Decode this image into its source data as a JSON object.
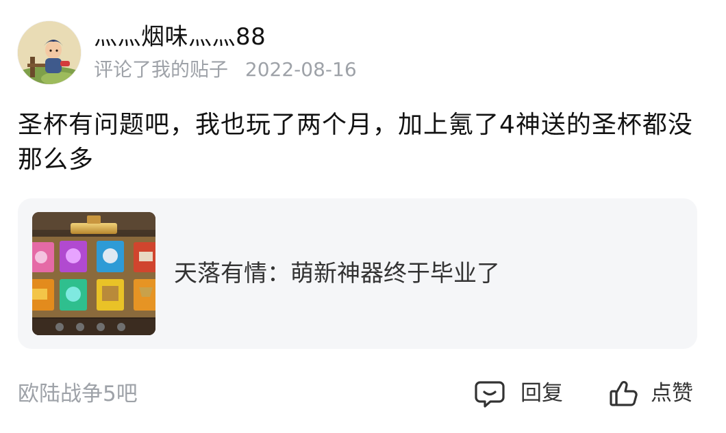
{
  "comment_item": {
    "user": {
      "name": "灬灬烟味灬灬88",
      "avatar": "avatar-icon"
    },
    "meta": {
      "action": "评论了我的贴子",
      "date": "2022-08-16"
    },
    "text": "圣杯有问题吧，我也玩了两个月，加上氪了4神送的圣杯都没那么多",
    "quoted_post": {
      "thumbnail": "game-screenshot-icon",
      "text": "天落有情：萌新神器终于毕业了"
    },
    "footer": {
      "source": "欧陆战争5吧",
      "reply_label": "回复",
      "reply_icon": "comment-icon",
      "like_label": "点赞",
      "like_icon": "thumbs-up-icon"
    }
  },
  "colors": {
    "primary_text": "#121212",
    "secondary_text": "#9ea2a8",
    "card_background": "#f5f6f8",
    "icon": "#333333"
  }
}
